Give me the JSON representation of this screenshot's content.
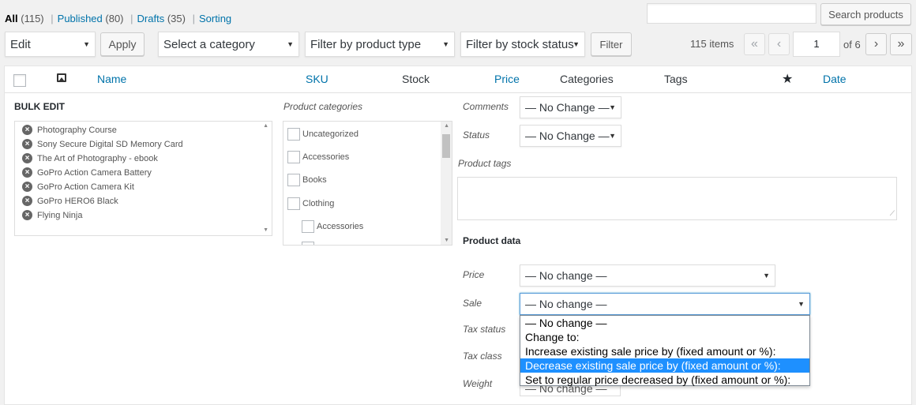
{
  "subsubsub": {
    "all_label": "All",
    "all_count": "(115)",
    "published_label": "Published",
    "published_count": "(80)",
    "drafts_label": "Drafts",
    "drafts_count": "(35)",
    "sorting_label": "Sorting",
    "separator": "|"
  },
  "search": {
    "button_label": "Search products",
    "value": ""
  },
  "tablenav": {
    "bulk_action": "Edit",
    "apply_label": "Apply",
    "category_filter": "Select a category",
    "product_type_filter": "Filter by product type",
    "stock_filter": "Filter by stock status",
    "filter_label": "Filter",
    "items_count": "115 items",
    "first_page": "«",
    "prev_page": "‹",
    "current_page": "1",
    "of_pages": "of 6",
    "next_page": "›",
    "last_page": "»"
  },
  "columns": {
    "name": "Name",
    "sku": "SKU",
    "stock": "Stock",
    "price": "Price",
    "categories": "Categories",
    "tags": "Tags",
    "featured_icon": "star-icon",
    "date": "Date",
    "image_icon": "image-icon"
  },
  "bulk_edit": {
    "title": "BULK EDIT",
    "products": [
      "Photography Course",
      "Sony Secure Digital SD Memory Card",
      "The Art of Photography - ebook",
      "GoPro Action Camera Battery",
      "GoPro Action Camera Kit",
      "GoPro HERO6 Black",
      "Flying Ninja"
    ],
    "categories_label": "Product categories",
    "categories": [
      "Uncategorized",
      "Accessories",
      "Books",
      "Clothing",
      "Accessories"
    ],
    "comments_label": "Comments",
    "comments_value": "— No Change —",
    "status_label": "Status",
    "status_value": "— No Change —",
    "tags_label": "Product tags",
    "product_data_title": "Product data",
    "price_label": "Price",
    "price_value": "— No change —",
    "sale_label": "Sale",
    "sale_value": "— No change —",
    "tax_status_label": "Tax status",
    "tax_class_label": "Tax class",
    "weight_label": "Weight",
    "weight_value": "— No change —"
  },
  "sale_dropdown": {
    "options": [
      "— No change —",
      "Change to:",
      "Increase existing sale price by (fixed amount or %):",
      "Decrease existing sale price by (fixed amount or %):",
      "Set to regular price decreased by (fixed amount or %):"
    ],
    "highlighted_index": 3,
    "highlight_color": "#1e90ff"
  },
  "colors": {
    "link": "#0073aa",
    "background": "#f1f1f1"
  }
}
